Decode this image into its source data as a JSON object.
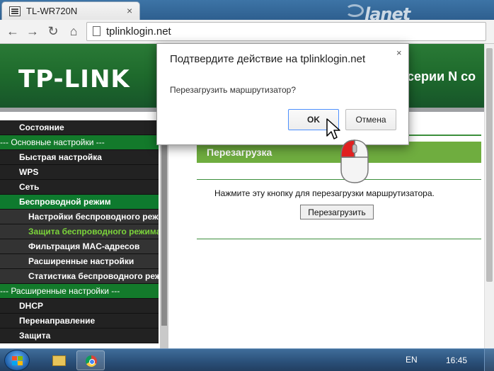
{
  "browser": {
    "tab_title": "TL-WR720N",
    "tab_close": "×",
    "url": "tplinklogin.net",
    "brand": "lanet",
    "nav": {
      "back": "←",
      "forward": "→",
      "reload": "↻",
      "home": "⌂"
    }
  },
  "page": {
    "logo": "TP-LINK",
    "banner_text": "серии N со",
    "menu": [
      {
        "label": "Состояние",
        "kind": "l0"
      },
      {
        "label": "--- Основные настройки ---",
        "kind": "section"
      },
      {
        "label": "Быстрая настройка",
        "kind": "l0"
      },
      {
        "label": "WPS",
        "kind": "l0"
      },
      {
        "label": "Сеть",
        "kind": "l0"
      },
      {
        "label": "Беспроводной режим",
        "kind": "active"
      },
      {
        "label": "Настройки беспроводного режима",
        "kind": "l1"
      },
      {
        "label": "Защита беспроводного режима",
        "kind": "l1 current"
      },
      {
        "label": "Фильтрация MAC-адресов",
        "kind": "l1"
      },
      {
        "label": "Расширенные настройки",
        "kind": "l1"
      },
      {
        "label": "Статистика беспроводного режима",
        "kind": "l1"
      },
      {
        "label": "--- Расширенные настройки ---",
        "kind": "section"
      },
      {
        "label": "DHCP",
        "kind": "l0"
      },
      {
        "label": "Перенаправление",
        "kind": "l0"
      },
      {
        "label": "Защита",
        "kind": "l0"
      }
    ],
    "section_title": "Перезагрузка",
    "description": "Нажмите эту кнопку для перезагрузки маршрутизатора.",
    "reboot_button": "Перезагрузить"
  },
  "dialog": {
    "title": "Подтвердите действие на tplinklogin.net",
    "message": "Перезагрузить маршрутизатор?",
    "ok": "OK",
    "cancel": "Отмена",
    "close": "×"
  },
  "taskbar": {
    "language": "EN",
    "time": "16:45"
  },
  "colors": {
    "banner_green": "#1e6a2c",
    "menu_section_green": "#137a2b",
    "current_item_lime": "#7bd43a",
    "section_header_green": "#6fad3f",
    "ok_focus_blue": "#4d90fe"
  }
}
